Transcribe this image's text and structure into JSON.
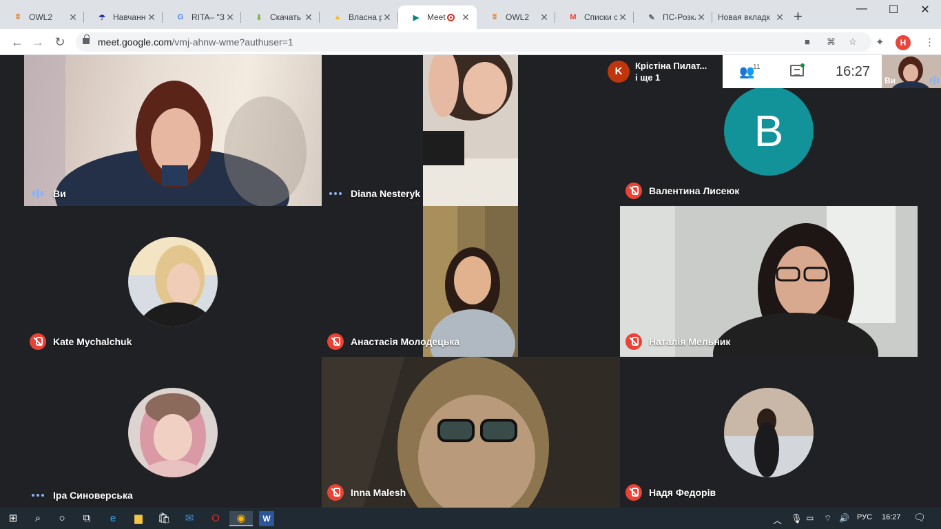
{
  "browser": {
    "tabs": [
      {
        "title": "OWL2",
        "fav_color": "#e8710a",
        "fav_glyph": "ʬ",
        "left": 0
      },
      {
        "title": "Навчанн",
        "fav_color": "#283593",
        "fav_glyph": "☂"
      },
      {
        "title": "RITA– \"Зн",
        "fav_color": "#4285f4",
        "fav_glyph": "G"
      },
      {
        "title": "Скачать",
        "fav_color": "#7cb342",
        "fav_glyph": "⬇"
      },
      {
        "title": "Власна р",
        "fav_color": "#fbbc04",
        "fav_glyph": "▲"
      },
      {
        "title": "Meet",
        "fav_color": "#00897b",
        "fav_glyph": "▶",
        "active": true
      },
      {
        "title": "OWL2",
        "fav_color": "#e8710a",
        "fav_glyph": "ʬ"
      },
      {
        "title": "Списки с",
        "fav_color": "#ea4335",
        "fav_glyph": "M"
      },
      {
        "title": "ПС-Розкл",
        "fav_color": "#5f6368",
        "fav_glyph": "✎"
      },
      {
        "title": "Новая вкладк",
        "fav_color": "#dee1e6",
        "fav_glyph": ""
      }
    ],
    "new_tab_label": "+",
    "url_host": "meet.google.com",
    "url_path": "/vmj-ahnw-wme?authuser=1",
    "profile_initial": "H"
  },
  "meet": {
    "presenter": {
      "initial": "K",
      "name_line1": "Крістіна Пилат...",
      "name_line2": "і ще 1"
    },
    "participants_count": "11",
    "clock": "16:27",
    "self_thumb_label": "Ви",
    "tiles": [
      {
        "name": "Ви",
        "status": "speaking"
      },
      {
        "name": "Diana Nesteryk",
        "status": "dots"
      },
      {
        "name": "Валентина Лисеюк",
        "status": "muted",
        "avatar_letter": "B"
      },
      {
        "name": "Kate Mychalchuk",
        "status": "muted"
      },
      {
        "name": "Анастасія Молодецька",
        "status": "muted"
      },
      {
        "name": "Наталія Мельник",
        "status": "muted"
      },
      {
        "name": "Іра Синоверська",
        "status": "dots"
      },
      {
        "name": "Inna Malesh",
        "status": "muted"
      },
      {
        "name": "Надя Федорів",
        "status": "muted"
      }
    ]
  },
  "taskbar": {
    "language": "РУС",
    "time": "16:27"
  },
  "colors": {
    "meet_bg": "#202124",
    "mute_red": "#ea4335",
    "accent_blue": "#8ab4f8",
    "avatar_teal": "#12939a"
  }
}
